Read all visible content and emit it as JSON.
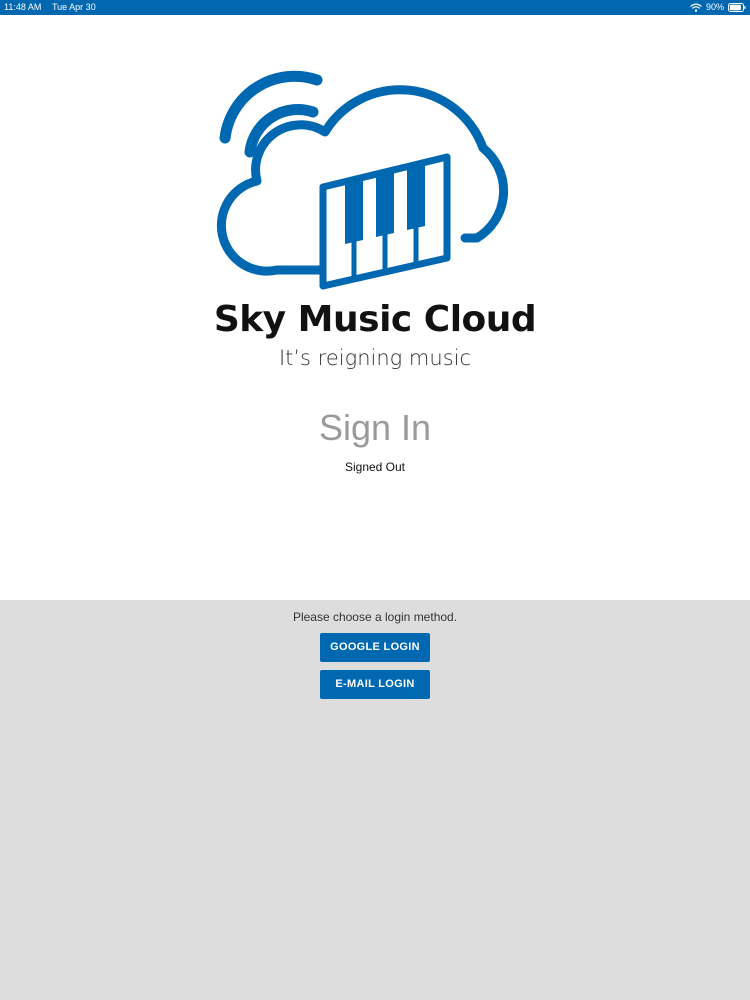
{
  "status_bar": {
    "time": "11:48 AM",
    "date": "Tue Apr 30",
    "battery": "90%",
    "battery_level": 0.9,
    "wifi_icon": "wifi-icon",
    "battery_icon": "battery-icon",
    "background_color": "#0067b1"
  },
  "brand": {
    "logo_icon": "cloud-piano-logo-icon",
    "name": "Sky Music Cloud",
    "tagline": "It’s reigning music",
    "accent_color": "#0067b1"
  },
  "auth": {
    "heading": "Sign In",
    "status": "Signed Out"
  },
  "login": {
    "prompt": "Please choose a login method.",
    "google_label": "GOOGLE LOGIN",
    "email_label": "E-MAIL LOGIN",
    "panel_color": "#deddde"
  }
}
